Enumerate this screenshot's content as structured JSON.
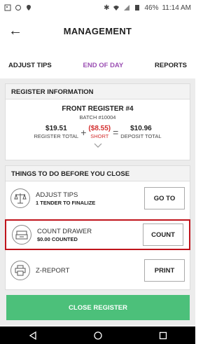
{
  "status_bar": {
    "battery": "46%",
    "time": "11:14 AM"
  },
  "header": {
    "title": "MANAGEMENT"
  },
  "tabs": [
    {
      "label": "ADJUST TIPS"
    },
    {
      "label": "END OF DAY"
    },
    {
      "label": "REPORTS"
    }
  ],
  "register": {
    "section_title": "REGISTER INFORMATION",
    "name": "FRONT REGISTER #4",
    "batch": "BATCH #10004",
    "register_total": "$19.51",
    "register_total_label": "REGISTER TOTAL",
    "plus": "+",
    "short": "($8.55)",
    "short_label": "SHORT",
    "equals": "=",
    "deposit_total": "$10.96",
    "deposit_total_label": "DEPOSIT TOTAL"
  },
  "todo": {
    "section_title": "THINGS TO DO BEFORE YOU CLOSE",
    "items": [
      {
        "label": "ADJUST TIPS",
        "sub": "1 TENDER TO FINALIZE",
        "button": "GO TO",
        "icon": "scale-icon"
      },
      {
        "label": "COUNT DRAWER",
        "sub": "$0.00 COUNTED",
        "button": "COUNT",
        "icon": "cash-drawer-icon"
      },
      {
        "label": "Z-REPORT",
        "sub": "",
        "button": "PRINT",
        "icon": "printer-icon"
      }
    ]
  },
  "close_button": "CLOSE REGISTER",
  "colors": {
    "accent": "#9b4fb3",
    "close": "#4cc07a",
    "short": "#d32f2f",
    "highlight": "#c0141c"
  }
}
